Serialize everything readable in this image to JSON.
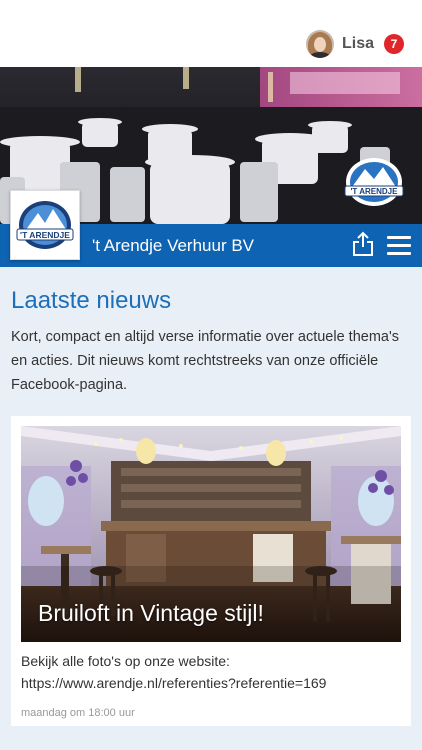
{
  "user": {
    "name": "Lisa",
    "notification_count": "7"
  },
  "brand": {
    "name": "'t Arendje Verhuur BV",
    "logo_text": "'T ARENDJE"
  },
  "news": {
    "title": "Laatste nieuws",
    "intro": "Kort, compact en altijd verse informatie over actuele thema's en acties. Dit nieuws komt rechtstreeks van onze officiële Facebook-pagina.",
    "posts": [
      {
        "caption": "Bruiloft in Vintage stijl!",
        "text_line1": "Bekijk alle foto's op onze website:",
        "text_line2": "https://www.arendje.nl/referenties?referentie=169",
        "time": "maandag om 18:00 uur"
      }
    ]
  },
  "colors": {
    "brand_blue": "#0e63b2",
    "title_blue": "#1c6fbb",
    "badge_red": "#e0262b",
    "page_bg": "#e9eff6"
  },
  "icons": {
    "share": "share-icon",
    "menu": "hamburger-menu-icon"
  }
}
